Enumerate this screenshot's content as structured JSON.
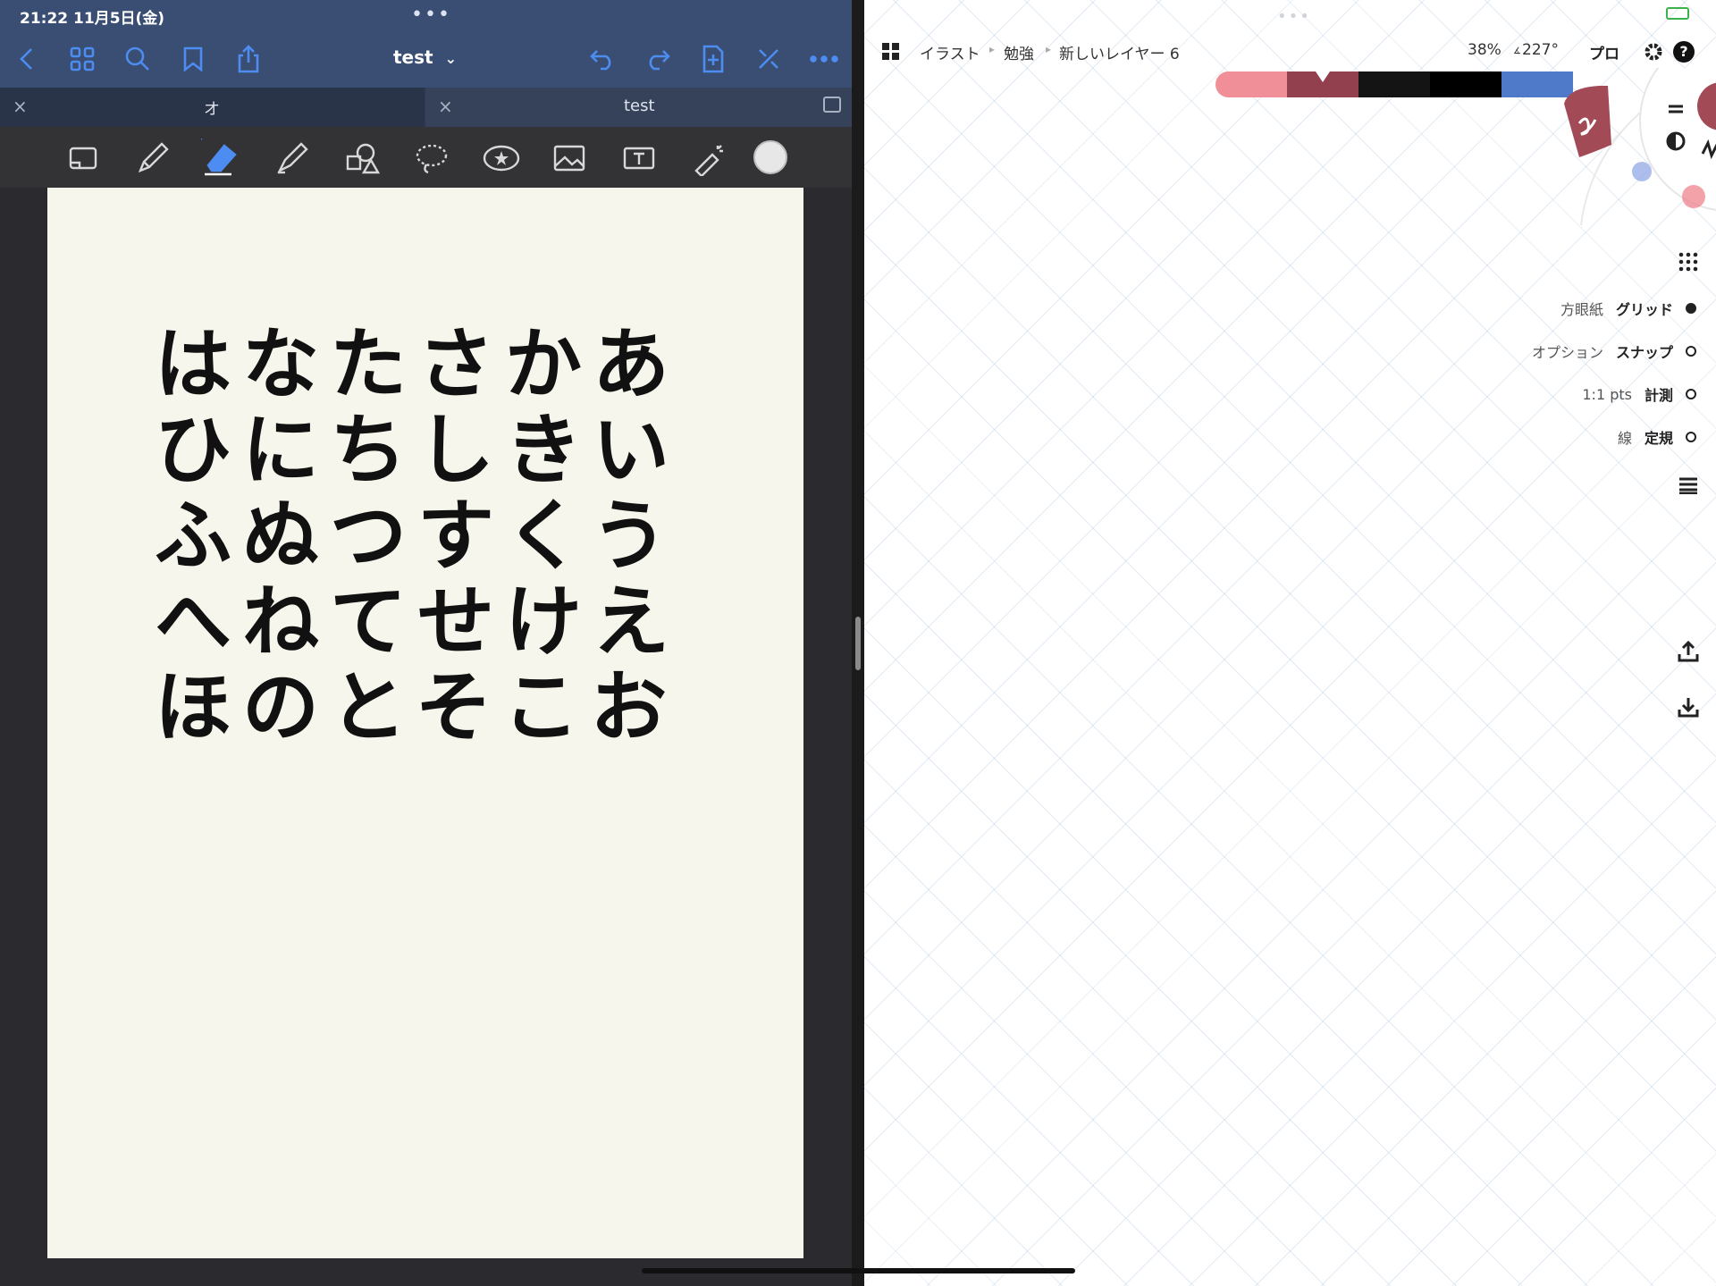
{
  "left": {
    "status": {
      "time_date": "21:22 11月5日(金)"
    },
    "nav": {
      "title": "test",
      "title_chevron": "⌄"
    },
    "tabs": [
      {
        "label": "オ"
      },
      {
        "label": "test"
      }
    ],
    "handwriting": [
      "はなたさかあ",
      "ひにちしきい",
      "ふぬつすくう",
      "へねてせけえ",
      "ほのとそこお"
    ]
  },
  "right": {
    "breadcrumb": [
      "イラスト",
      "勉強",
      "新しいレイヤー 6"
    ],
    "zoom": "38%",
    "angle": "227°",
    "pro": "プロ",
    "color_strip": [
      "#f08f98",
      "#923f4e",
      "#141414",
      "#000000",
      "#4f79c9"
    ],
    "current_color": "#a34a57",
    "options": [
      {
        "key": "方眼紙",
        "value": "グリッド",
        "on": true
      },
      {
        "key": "オプション",
        "value": "スナップ",
        "on": false
      },
      {
        "key": "1:1 pts",
        "value": "計測",
        "on": false
      },
      {
        "key": "線",
        "value": "定規",
        "on": false
      }
    ]
  }
}
